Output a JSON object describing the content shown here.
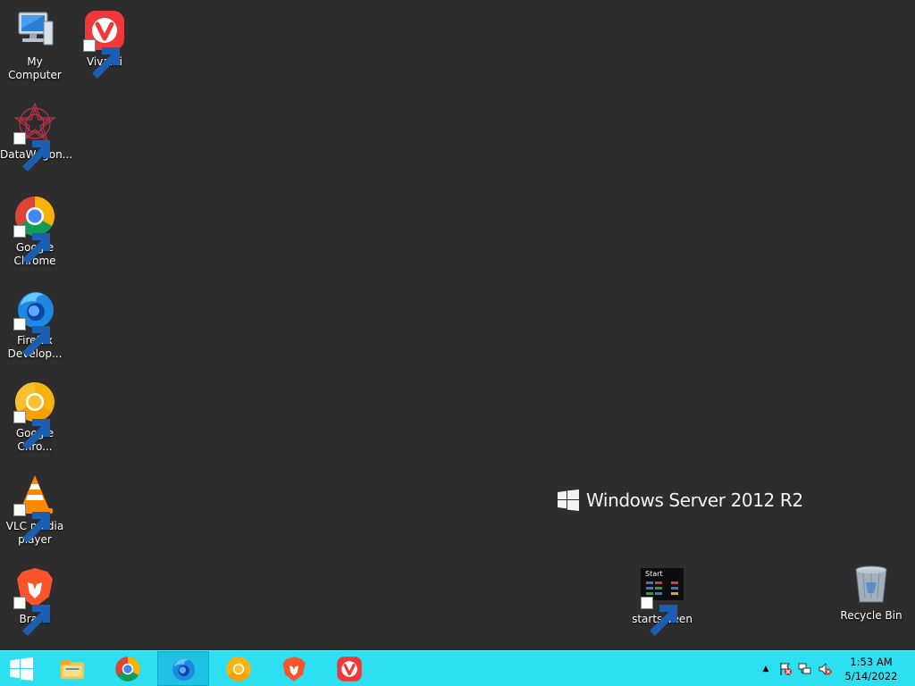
{
  "desktop": {
    "icons": [
      {
        "label": "My Computer",
        "icon": "computer-icon"
      },
      {
        "label": "Vivaldi",
        "icon": "vivaldi-icon"
      },
      {
        "label": "DataWagon...",
        "icon": "datawagon-icon"
      },
      {
        "label": "Google Chrome",
        "icon": "chrome-icon"
      },
      {
        "label": "Firefox Develop...",
        "icon": "firefox-developer-icon"
      },
      {
        "label": "Google Chro...",
        "icon": "chrome-canary-icon"
      },
      {
        "label": "VLC media player",
        "icon": "vlc-icon"
      },
      {
        "label": "Brave",
        "icon": "brave-icon"
      },
      {
        "label": "startscreen",
        "icon": "startscreen-icon"
      },
      {
        "label": "Recycle Bin",
        "icon": "recycle-bin-icon"
      }
    ],
    "startscreen_thumb_text": "Start",
    "watermark": "Windows Server 2012 R2"
  },
  "taskbar": {
    "color": "#2ce0f2",
    "buttons": [
      "start-icon",
      "file-explorer-icon",
      "chrome-icon",
      "firefox-developer-icon",
      "chrome-canary-icon",
      "brave-icon",
      "vivaldi-icon"
    ],
    "tray": {
      "overflow_glyph": "▲",
      "time": "1:53 AM",
      "date": "5/14/2022"
    }
  }
}
